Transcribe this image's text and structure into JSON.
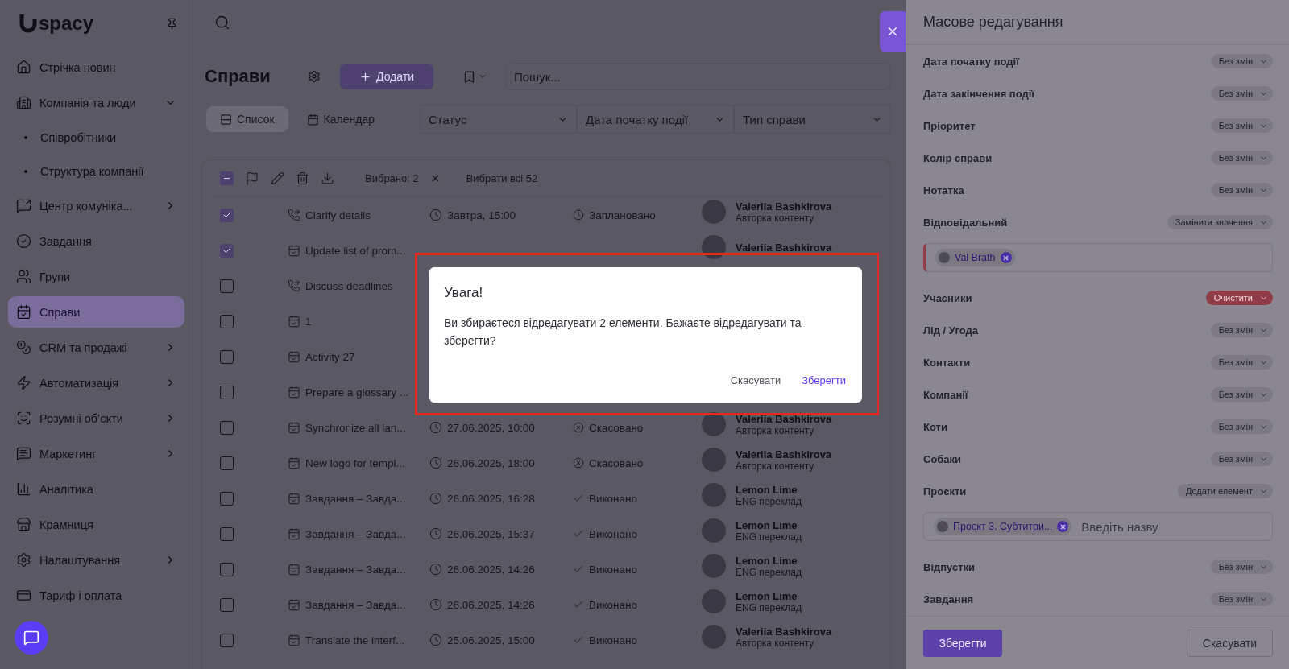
{
  "sidebar": {
    "logo": "spacy",
    "items": [
      {
        "label": "Стрічка новин",
        "selected": false
      },
      {
        "label": "Компанія та люди",
        "selected": false,
        "expanded": true,
        "children": [
          {
            "label": "Співробітники",
            "selected": false
          },
          {
            "label": "Структура компанії",
            "selected": false
          }
        ]
      },
      {
        "label": "Центр комуніка...",
        "selected": false,
        "expanded": false
      },
      {
        "label": "Завдання",
        "selected": false
      },
      {
        "label": "Групи",
        "selected": false
      },
      {
        "label": "Справи",
        "selected": true
      },
      {
        "label": "CRM та продажі",
        "selected": false,
        "expanded": false
      },
      {
        "label": "Автоматизація",
        "selected": false,
        "expanded": false
      },
      {
        "label": "Розумні об’єкти",
        "selected": false,
        "expanded": false
      },
      {
        "label": "Маркетинг",
        "selected": false,
        "expanded": false
      },
      {
        "label": "Аналітика",
        "selected": false
      },
      {
        "label": "Крамниця",
        "selected": false
      },
      {
        "label": "Налаштування",
        "selected": false,
        "expanded": false
      },
      {
        "label": "Тариф і оплата",
        "selected": false
      }
    ]
  },
  "main": {
    "title": "Справи",
    "add_button": "Додати",
    "search": {
      "placeholder": "Пошук..."
    },
    "view_tabs": [
      {
        "label": "Список",
        "selected": true
      },
      {
        "label": "Календар",
        "selected": false
      }
    ],
    "filters": [
      "Статус",
      "Дата початку події",
      "Тип справи"
    ],
    "toolbar": {
      "indeterminate": true,
      "selected_count": "Вибрано: 2",
      "select_all": "Вибрати всі 52"
    },
    "rows": [
      {
        "kind": "call",
        "title": "Clarify details",
        "checked": true,
        "date": "Завтра, 15:00",
        "status": {
          "kind": "planned",
          "label": "Заплановано"
        },
        "person": {
          "name": "Valeriia Bashkirova",
          "role": "Авторка контенту"
        }
      },
      {
        "kind": "task",
        "title": "Update list of prom...",
        "checked": true,
        "person": {
          "name": "Valeriia Bashkirova"
        }
      },
      {
        "kind": "call",
        "title": "Discuss deadlines",
        "checked": false
      },
      {
        "kind": "task",
        "title": "1",
        "checked": false
      },
      {
        "kind": "task",
        "title": "Activity 27",
        "checked": false
      },
      {
        "kind": "task",
        "title": "Prepare a glossary ...",
        "checked": false
      },
      {
        "kind": "task",
        "title": "Synchronize all lan...",
        "checked": false,
        "date": "27.06.2025, 10:00",
        "status": {
          "kind": "cancelled",
          "label": "Скасовано"
        },
        "person": {
          "name": "Valeriia Bashkirova",
          "role": "Авторка контенту"
        }
      },
      {
        "kind": "task",
        "title": "New logo for templ...",
        "checked": false,
        "date": "26.06.2025, 18:00",
        "status": {
          "kind": "cancelled",
          "label": "Скасовано"
        },
        "person": {
          "name": "Valeriia Bashkirova",
          "role": "Авторка контенту"
        }
      },
      {
        "kind": "task",
        "title": "Завдання – Завда...",
        "checked": false,
        "date": "26.06.2025, 16:28",
        "status": {
          "kind": "done",
          "label": "Виконано"
        },
        "person": {
          "name": "Lemon Lime",
          "role": "ENG переклад"
        }
      },
      {
        "kind": "task",
        "title": "Завдання – Завда...",
        "checked": false,
        "date": "26.06.2025, 15:37",
        "status": {
          "kind": "done",
          "label": "Виконано"
        },
        "person": {
          "name": "Lemon Lime",
          "role": "ENG переклад"
        }
      },
      {
        "kind": "task",
        "title": "Завдання – Завда...",
        "checked": false,
        "date": "26.06.2025, 14:26",
        "status": {
          "kind": "done",
          "label": "Виконано"
        },
        "person": {
          "name": "Lemon Lime",
          "role": "ENG переклад"
        }
      },
      {
        "kind": "task",
        "title": "Завдання – Завда...",
        "checked": false,
        "date": "26.06.2025, 14:26",
        "status": {
          "kind": "done",
          "label": "Виконано"
        },
        "person": {
          "name": "Lemon Lime",
          "role": "ENG переклад"
        }
      },
      {
        "kind": "task",
        "title": "Translate the interf...",
        "checked": false,
        "date": "25.06.2025, 15:00",
        "status": {
          "kind": "done",
          "label": "Виконано"
        },
        "person": {
          "name": "Valeriia Bashkirova",
          "role": "Авторка контенту"
        }
      }
    ]
  },
  "drawer": {
    "title": "Масове редагування",
    "fields": [
      {
        "kind": "option",
        "label": "Дата початку події",
        "action": "Без змін",
        "destructive": false
      },
      {
        "kind": "option",
        "label": "Дата закінчення події",
        "action": "Без змін",
        "destructive": false
      },
      {
        "kind": "option",
        "label": "Пріоритет",
        "action": "Без змін",
        "destructive": false
      },
      {
        "kind": "option",
        "label": "Колір справи",
        "action": "Без змін",
        "destructive": false
      },
      {
        "kind": "option",
        "label": "Нотатка",
        "action": "Без змін",
        "destructive": false
      },
      {
        "kind": "option",
        "label": "Відповідальний",
        "action": "Замінити значення",
        "destructive": false
      },
      {
        "kind": "picker",
        "error": true,
        "chips": [
          "Val Brath"
        ]
      },
      {
        "kind": "option",
        "label": "Учасники",
        "action": "Очистити",
        "destructive": true
      },
      {
        "kind": "option",
        "label": "Лід / Угода",
        "action": "Без змін",
        "destructive": false
      },
      {
        "kind": "option",
        "label": "Контакти",
        "action": "Без змін",
        "destructive": false
      },
      {
        "kind": "option",
        "label": "Компанії",
        "action": "Без змін",
        "destructive": false
      },
      {
        "kind": "option",
        "label": "Коти",
        "action": "Без змін",
        "destructive": false
      },
      {
        "kind": "option",
        "label": "Собаки",
        "action": "Без змін",
        "destructive": false
      },
      {
        "kind": "option",
        "label": "Проєкти",
        "action": "Додати елемент",
        "destructive": false
      },
      {
        "kind": "picker",
        "error": false,
        "chips": [
          "Проєкт 3. Субтитри..."
        ],
        "placeholder": "Введіть назву"
      },
      {
        "kind": "option",
        "label": "Відпустки",
        "action": "Без змін",
        "destructive": false
      },
      {
        "kind": "option",
        "label": "Завдання",
        "action": "Без змін",
        "destructive": false
      }
    ],
    "save": "Зберегти",
    "cancel": "Скасувати"
  },
  "dialog": {
    "title": "Увага!",
    "message": "Ви збираєтеся відредагувати 2 елементи. Бажаєте відредагувати та зберегти?",
    "buttons": [
      {
        "kind": "secondary",
        "label": "Скасувати"
      },
      {
        "kind": "primary",
        "label": "Зберегти"
      }
    ]
  }
}
